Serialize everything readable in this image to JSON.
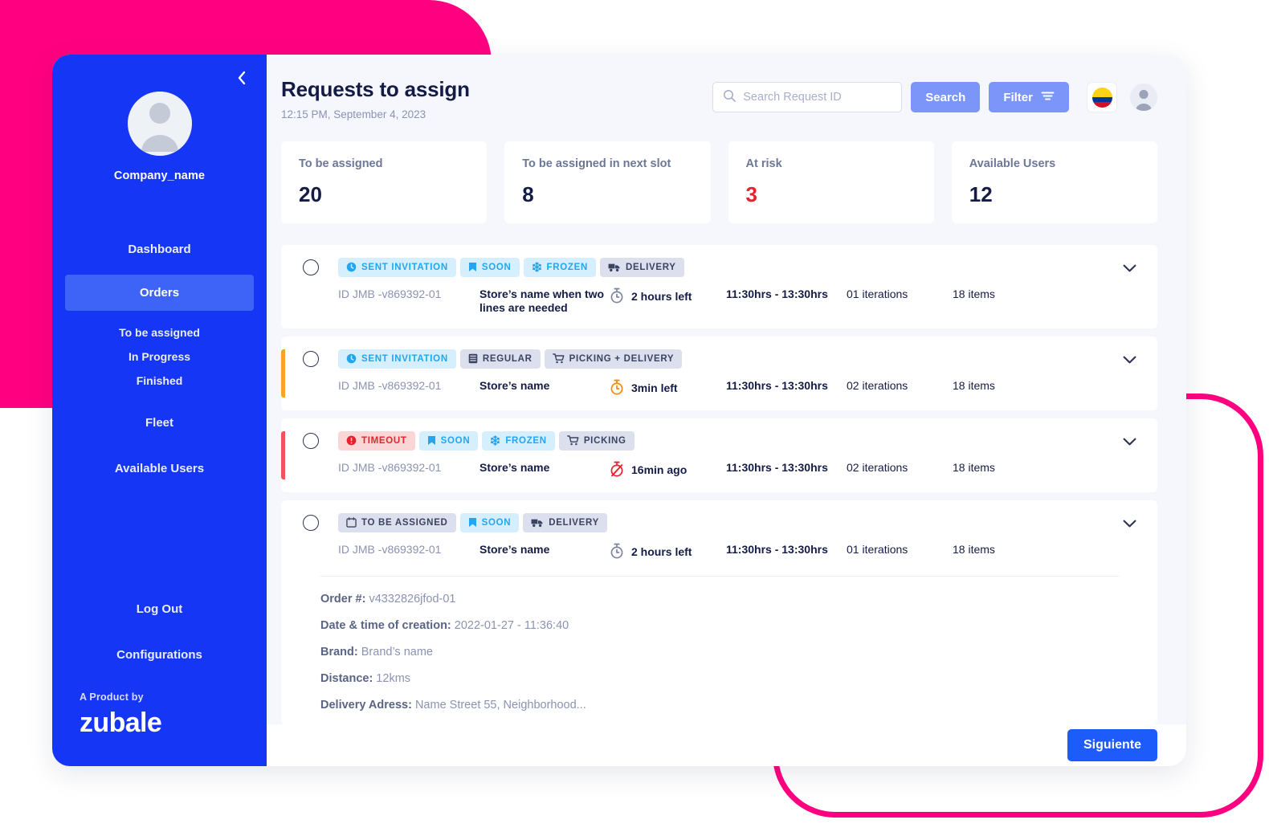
{
  "decor": {
    "pink": "#FF0080"
  },
  "sidebar": {
    "collapse_icon": "chevron-left-icon",
    "avatar_icon": "user-avatar-icon",
    "company_name": "Company_name",
    "items": [
      {
        "label": "Dashboard",
        "type": "item",
        "active": false
      },
      {
        "label": "Orders",
        "type": "item",
        "active": true
      },
      {
        "label": "To be assigned",
        "type": "sub",
        "active": false
      },
      {
        "label": "In Progress",
        "type": "sub",
        "active": false
      },
      {
        "label": "Finished",
        "type": "sub",
        "active": false
      },
      {
        "label": "Fleet",
        "type": "item",
        "active": false
      },
      {
        "label": "Available Users",
        "type": "item",
        "active": false
      }
    ],
    "bottom_items": [
      {
        "label": "Log Out"
      },
      {
        "label": "Configurations"
      }
    ],
    "footer": {
      "product_by": "A Product by",
      "brand": "zubale"
    },
    "bg_color": "#1536F5",
    "active_color": "#3D64F7"
  },
  "header": {
    "title": "Requests to assign",
    "subtitle": "12:15 PM, September 4, 2023",
    "search": {
      "placeholder": "Search Request ID",
      "value": "",
      "icon": "search-icon"
    },
    "search_button": "Search",
    "filter_button": "Filter",
    "filter_icon": "filter-icon",
    "flag": "colombia-flag-icon",
    "account_icon": "user-account-icon"
  },
  "stats": [
    {
      "label": "To be assigned",
      "value": "20",
      "accent": "#141C46"
    },
    {
      "label": "To be assigned in next slot",
      "value": "8",
      "accent": "#141C46"
    },
    {
      "label": "At risk",
      "value": "3",
      "accent": "#E8212E"
    },
    {
      "label": "Available Users",
      "value": "12",
      "accent": "#141C46"
    }
  ],
  "orders": [
    {
      "accent": "transparent",
      "badges": [
        {
          "label": "SENT INVITATION",
          "tone": "blue",
          "icon": "clock-icon"
        },
        {
          "label": "SOON",
          "tone": "blue",
          "icon": "bookmark-icon"
        },
        {
          "label": "FROZEN",
          "tone": "blue",
          "icon": "snowflake-icon"
        },
        {
          "label": "DELIVERY",
          "tone": "gray",
          "icon": "truck-icon"
        }
      ],
      "id": "ID JMB -v869392-01",
      "store": "Store’s name when two lines are needed",
      "timer": "2 hours left",
      "timer_icon": "stopwatch-icon",
      "timer_tone": "gray",
      "slot": "11:30hrs - 13:30hrs",
      "iterations": "01 iterations",
      "items": "18 items",
      "expanded": false
    },
    {
      "accent": "#F5A623",
      "badges": [
        {
          "label": "SENT INVITATION",
          "tone": "blue",
          "icon": "clock-icon"
        },
        {
          "label": "REGULAR",
          "tone": "gray",
          "icon": "box-icon"
        },
        {
          "label": "PICKING + DELIVERY",
          "tone": "gray",
          "icon": "cart-icon"
        }
      ],
      "id": "ID JMB -v869392-01",
      "store": "Store’s name",
      "timer": "3min left",
      "timer_icon": "stopwatch-icon",
      "timer_tone": "orange",
      "slot": "11:30hrs - 13:30hrs",
      "iterations": "02 iterations",
      "items": "18 items",
      "expanded": false
    },
    {
      "accent": "#F4515B",
      "badges": [
        {
          "label": "TIMEOUT",
          "tone": "red",
          "icon": "alert-circle-icon"
        },
        {
          "label": "SOON",
          "tone": "blue",
          "icon": "bookmark-icon"
        },
        {
          "label": "FROZEN",
          "tone": "blue",
          "icon": "snowflake-icon"
        },
        {
          "label": "PICKING",
          "tone": "gray",
          "icon": "cart-icon"
        }
      ],
      "id": "ID JMB -v869392-01",
      "store": "Store’s name",
      "timer": "16min ago",
      "timer_icon": "stopwatch-off-icon",
      "timer_tone": "red",
      "slot": "11:30hrs - 13:30hrs",
      "iterations": "02 iterations",
      "items": "18 items",
      "expanded": false
    },
    {
      "accent": "transparent",
      "badges": [
        {
          "label": "TO BE ASSIGNED",
          "tone": "gray",
          "icon": "calendar-icon"
        },
        {
          "label": "SOON",
          "tone": "blue",
          "icon": "bookmark-icon"
        },
        {
          "label": "DELIVERY",
          "tone": "gray",
          "icon": "truck-icon"
        }
      ],
      "id": "ID JMB -v869392-01",
      "store": "Store’s name",
      "timer": "2 hours left",
      "timer_icon": "stopwatch-icon",
      "timer_tone": "gray",
      "slot": "11:30hrs - 13:30hrs",
      "iterations": "01 iterations",
      "items": "18 items",
      "expanded": true,
      "details": [
        {
          "label": "Order #:",
          "value": "v4332826jfod-01"
        },
        {
          "label": "Date & time of creation:",
          "value": "2022-01-27 - 11:36:40"
        },
        {
          "label": "Brand:",
          "value": "Brand’s name"
        },
        {
          "label": "Distance:",
          "value": "12kms"
        },
        {
          "label": "Delivery Adress:",
          "value": "Name Street 55, Neighborhood..."
        }
      ]
    }
  ],
  "footer": {
    "next_button": "Siguiente"
  }
}
